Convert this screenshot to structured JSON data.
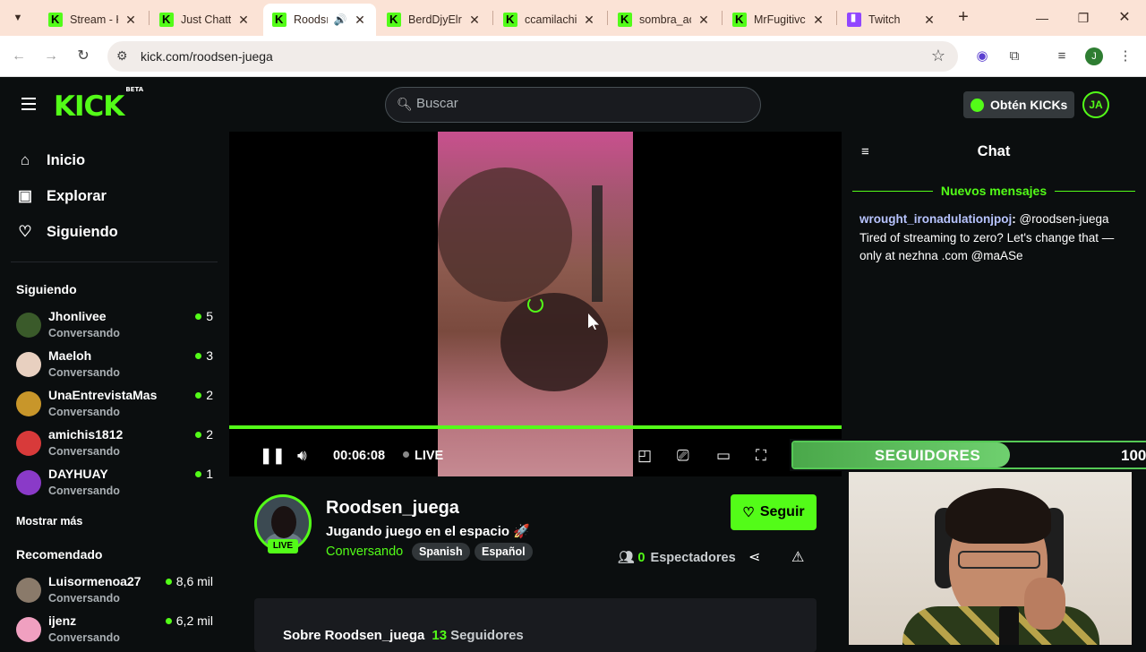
{
  "browser": {
    "tabs": [
      {
        "title": "Stream - K",
        "icon": "kick"
      },
      {
        "title": "Just Chatti",
        "icon": "kick"
      },
      {
        "title": "Roodsı",
        "icon": "kick",
        "active": true,
        "audio": true
      },
      {
        "title": "BerdDjyElr",
        "icon": "kick"
      },
      {
        "title": "ccamilachi",
        "icon": "kick"
      },
      {
        "title": "sombra_ac",
        "icon": "kick"
      },
      {
        "title": "MrFugitivc",
        "icon": "kick"
      },
      {
        "title": "Twitch",
        "icon": "twitch"
      }
    ],
    "url": "kick.com/roodsen-juega",
    "profile_initial": "J"
  },
  "header": {
    "logo": "KICK",
    "logo_badge": "BETA",
    "search_placeholder": "Buscar",
    "get_kicks_label": "Obtén KICKs",
    "user_initials": "JA"
  },
  "sidebar": {
    "nav": [
      {
        "label": "Inicio",
        "icon": "home-icon"
      },
      {
        "label": "Explorar",
        "icon": "browse-icon"
      },
      {
        "label": "Siguiendo",
        "icon": "heart-icon"
      }
    ],
    "following_title": "Siguiendo",
    "following": [
      {
        "name": "Jhonlivee",
        "category": "Conversando",
        "viewers": "5",
        "color": "#3a5a2a"
      },
      {
        "name": "Maeloh",
        "category": "Conversando",
        "viewers": "3",
        "color": "#e8d0c0"
      },
      {
        "name": "UnaEntrevistaMas",
        "category": "Conversando",
        "viewers": "2",
        "color": "#c8962a"
      },
      {
        "name": "amichis1812",
        "category": "Conversando",
        "viewers": "2",
        "color": "#d83a3a"
      },
      {
        "name": "DAYHUAY",
        "category": "Conversando",
        "viewers": "1",
        "color": "#8a3ac8"
      }
    ],
    "show_more": "Mostrar más",
    "recommended_title": "Recomendado",
    "recommended": [
      {
        "name": "Luisormenoa27",
        "category": "Conversando",
        "viewers": "8,6 mil",
        "color": "#8a7a6a"
      },
      {
        "name": "ijenz",
        "category": "Conversando",
        "viewers": "6,2 mil",
        "color": "#f0a0c0"
      }
    ]
  },
  "player": {
    "time": "00:06:08",
    "live_label": "LIVE"
  },
  "overlay": {
    "followers_label": "SEGUIDORES",
    "followers_goal": "100"
  },
  "chat": {
    "title": "Chat",
    "new_messages": "Nuevos mensajes",
    "messages": [
      {
        "user": "wrought_ironadulationjpoj",
        "text": "@roodsen-juega Tired of streaming to zero? Let's change that — only at nezhna .com @maASe"
      }
    ]
  },
  "channel": {
    "name": "Roodsen_juega",
    "stream_title": "Jugando juego en el espacio 🚀",
    "category": "Conversando",
    "tags": [
      "Spanish",
      "Español"
    ],
    "live_badge": "LIVE",
    "follow_label": "Seguir",
    "viewers_count": "0",
    "viewers_label": "Espectadores",
    "about_title": "Sobre Roodsen_juega",
    "followers_count": "13",
    "followers_label": "Seguidores"
  },
  "colors": {
    "accent": "#53fc18",
    "background": "#0b0e0f"
  }
}
